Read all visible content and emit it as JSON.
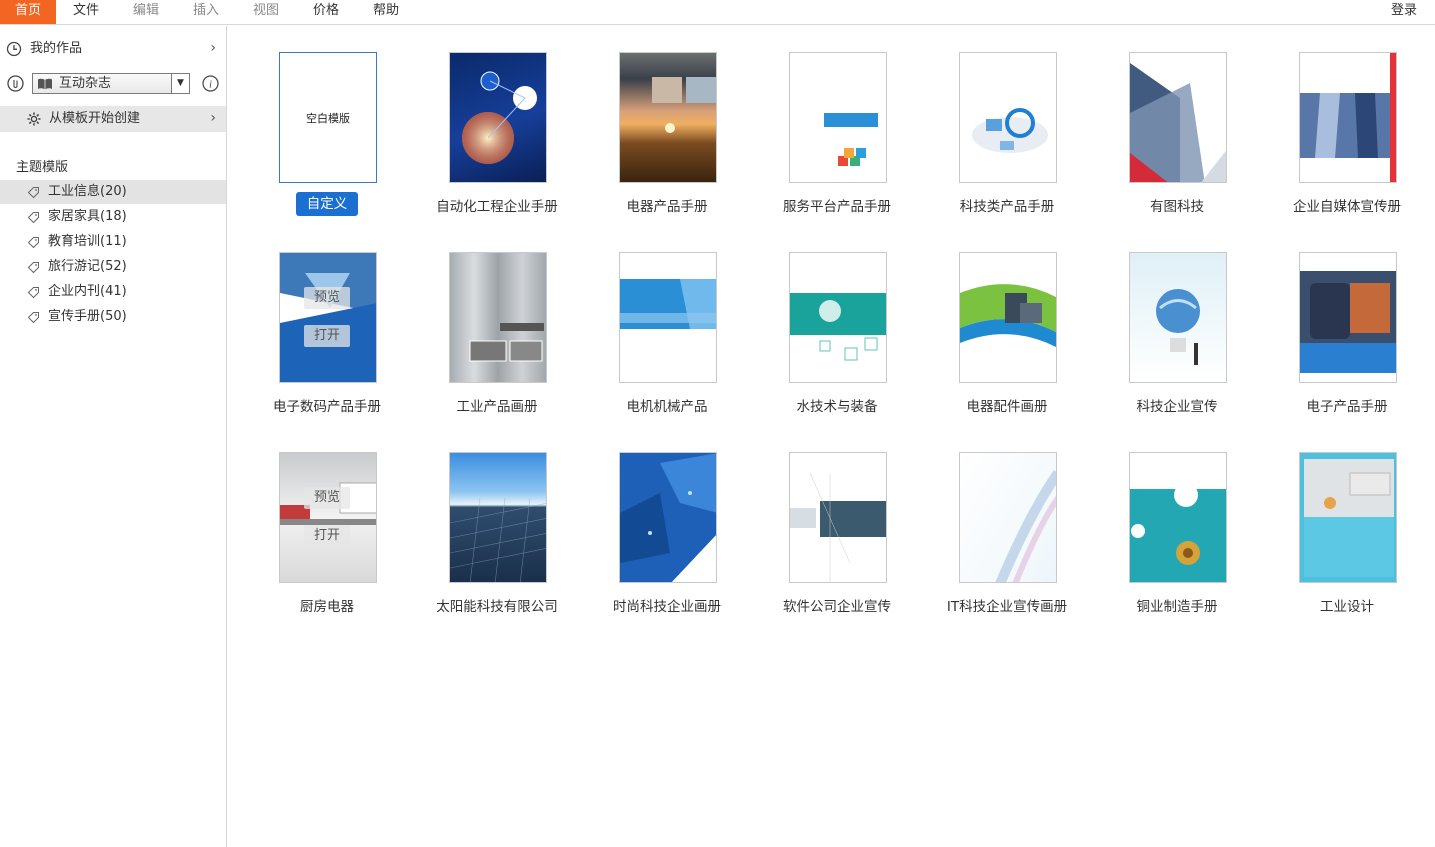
{
  "menu": {
    "items": [
      {
        "label": "首页"
      },
      {
        "label": "文件"
      },
      {
        "label": "编辑"
      },
      {
        "label": "插入"
      },
      {
        "label": "视图"
      },
      {
        "label": "价格"
      },
      {
        "label": "帮助"
      }
    ],
    "login": "登录"
  },
  "sidebar": {
    "my_works": "我的作品",
    "magazine_select": "互动杂志",
    "from_template": "从模板开始创建",
    "section_title": "主题模版",
    "categories": [
      {
        "label": "工业信息(20)"
      },
      {
        "label": "家居家具(18)"
      },
      {
        "label": "教育培训(11)"
      },
      {
        "label": "旅行游记(52)"
      },
      {
        "label": "企业内刊(41)"
      },
      {
        "label": "宣传手册(50)"
      }
    ]
  },
  "grid": {
    "blank_thumb_text": "空白模版",
    "custom_button": "自定义",
    "preview_label": "预览",
    "open_label": "打开",
    "templates": [
      {
        "label": "自动化工程企业手册"
      },
      {
        "label": "电器产品手册"
      },
      {
        "label": "服务平台产品手册"
      },
      {
        "label": "科技类产品手册"
      },
      {
        "label": "有图科技"
      },
      {
        "label": "企业自媒体宣传册"
      },
      {
        "label": "电子数码产品手册"
      },
      {
        "label": "工业产品画册"
      },
      {
        "label": "电机机械产品"
      },
      {
        "label": "水技术与装备"
      },
      {
        "label": "电器配件画册"
      },
      {
        "label": "科技企业宣传"
      },
      {
        "label": "电子产品手册"
      },
      {
        "label": "厨房电器"
      },
      {
        "label": "太阳能科技有限公司"
      },
      {
        "label": "时尚科技企业画册"
      },
      {
        "label": "软件公司企业宣传"
      },
      {
        "label": "IT科技企业宣传画册"
      },
      {
        "label": "铜业制造手册"
      },
      {
        "label": "工业设计"
      }
    ]
  },
  "colors": {
    "accent": "#f26522",
    "button_blue": "#1a6fd1",
    "selected_row": "#e3e3e3"
  }
}
